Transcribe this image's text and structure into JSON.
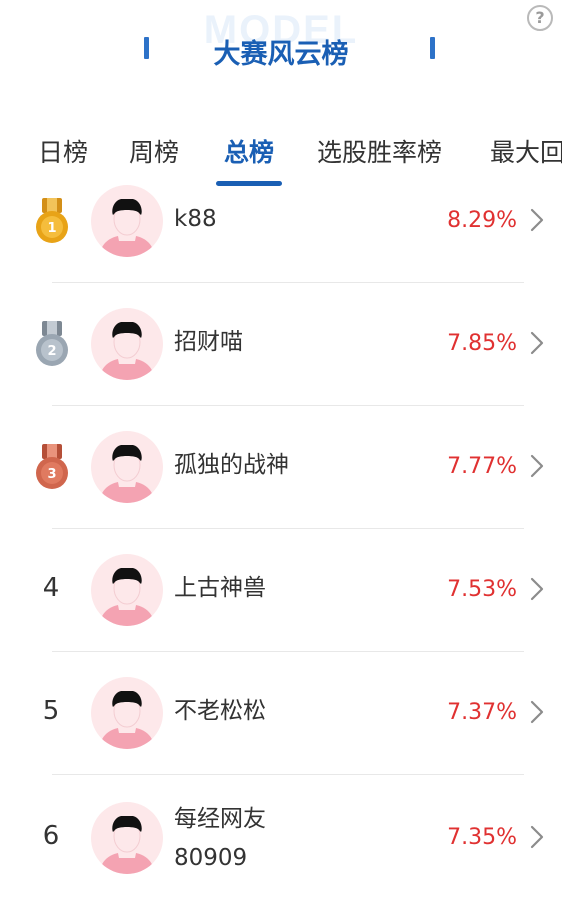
{
  "header": {
    "watermark": "MODEL",
    "title": "大赛风云榜",
    "help_symbol": "?"
  },
  "tabs": [
    {
      "label": "日榜"
    },
    {
      "label": "周榜"
    },
    {
      "label": "总榜",
      "active": true
    },
    {
      "label": "选股胜率榜"
    },
    {
      "label": "最大回"
    }
  ],
  "colors": {
    "accent": "#1a5fb4",
    "value": "#e03131",
    "gold": "#e8a317",
    "silver": "#9aa6b2",
    "bronze": "#d0664d"
  },
  "leaderboard": [
    {
      "rank": "1",
      "medal": "gold-medal-icon",
      "name": "k88",
      "value": "8.29%"
    },
    {
      "rank": "2",
      "medal": "silver-medal-icon",
      "name": "招财喵",
      "value": "7.85%"
    },
    {
      "rank": "3",
      "medal": "bronze-medal-icon",
      "name": "孤独的战神",
      "value": "7.77%"
    },
    {
      "rank": "4",
      "name": "上古神兽",
      "value": "7.53%"
    },
    {
      "rank": "5",
      "name": "不老松松",
      "value": "7.37%"
    },
    {
      "rank": "6",
      "name": "每经网友",
      "name_line2": "80909",
      "value": "7.35%"
    }
  ]
}
